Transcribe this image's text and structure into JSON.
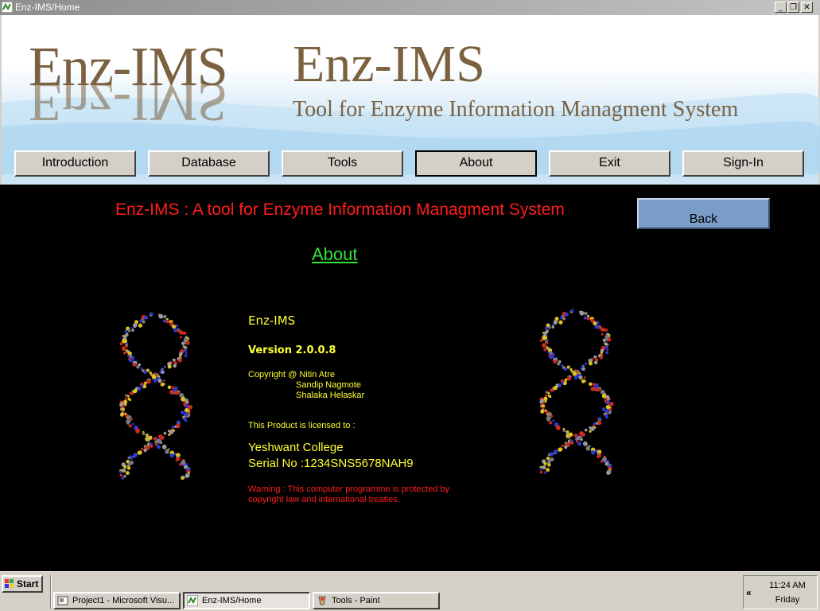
{
  "window": {
    "title": "Enz-IMS/Home",
    "minimize_glyph": "_",
    "restore_glyph": "❐",
    "close_glyph": "✕"
  },
  "header": {
    "logo_text": "Enz-IMS",
    "app_title": "Enz-IMS",
    "tagline": "Tool for Enzyme Information Managment System"
  },
  "nav": {
    "items": [
      {
        "label": "Introduction"
      },
      {
        "label": "Database"
      },
      {
        "label": "Tools"
      },
      {
        "label": "About"
      },
      {
        "label": "Exit"
      },
      {
        "label": "Sign-In"
      }
    ],
    "active": "About"
  },
  "main": {
    "headline": "Enz-IMS : A tool for Enzyme Information Managment System",
    "back_label": "Back",
    "section_link": "About",
    "app_name": "Enz-IMS",
    "version": "Version 2.0.0.8",
    "copyright_line": "Copyright @ Nitin Atre",
    "authors": [
      "Sandip Nagmote",
      "Shalaka Helaskar"
    ],
    "licensed_label": "This Product is licensed to :",
    "licensee": "Yeshwant College",
    "serial": "Serial No :1234SNS5678NAH9",
    "warning": "Warning : This computer programme is protected by copyright law and international treaties."
  },
  "taskbar": {
    "start_label": "Start",
    "tasks": [
      {
        "label": "Project1 - Microsoft Visu...",
        "icon": "vb-project-icon"
      },
      {
        "label": "Enz-IMS/Home",
        "icon": "app-icon"
      },
      {
        "label": "Tools - Paint",
        "icon": "paint-icon"
      }
    ],
    "tray_chevron": "«",
    "time": "11:24 AM",
    "day": "Friday"
  },
  "colors": {
    "brand_brown": "#7b6140",
    "headline_red": "#ff1c1c",
    "link_green": "#35e03a",
    "info_yellow": "#ffff33",
    "back_button_blue": "#7a9cc8"
  }
}
